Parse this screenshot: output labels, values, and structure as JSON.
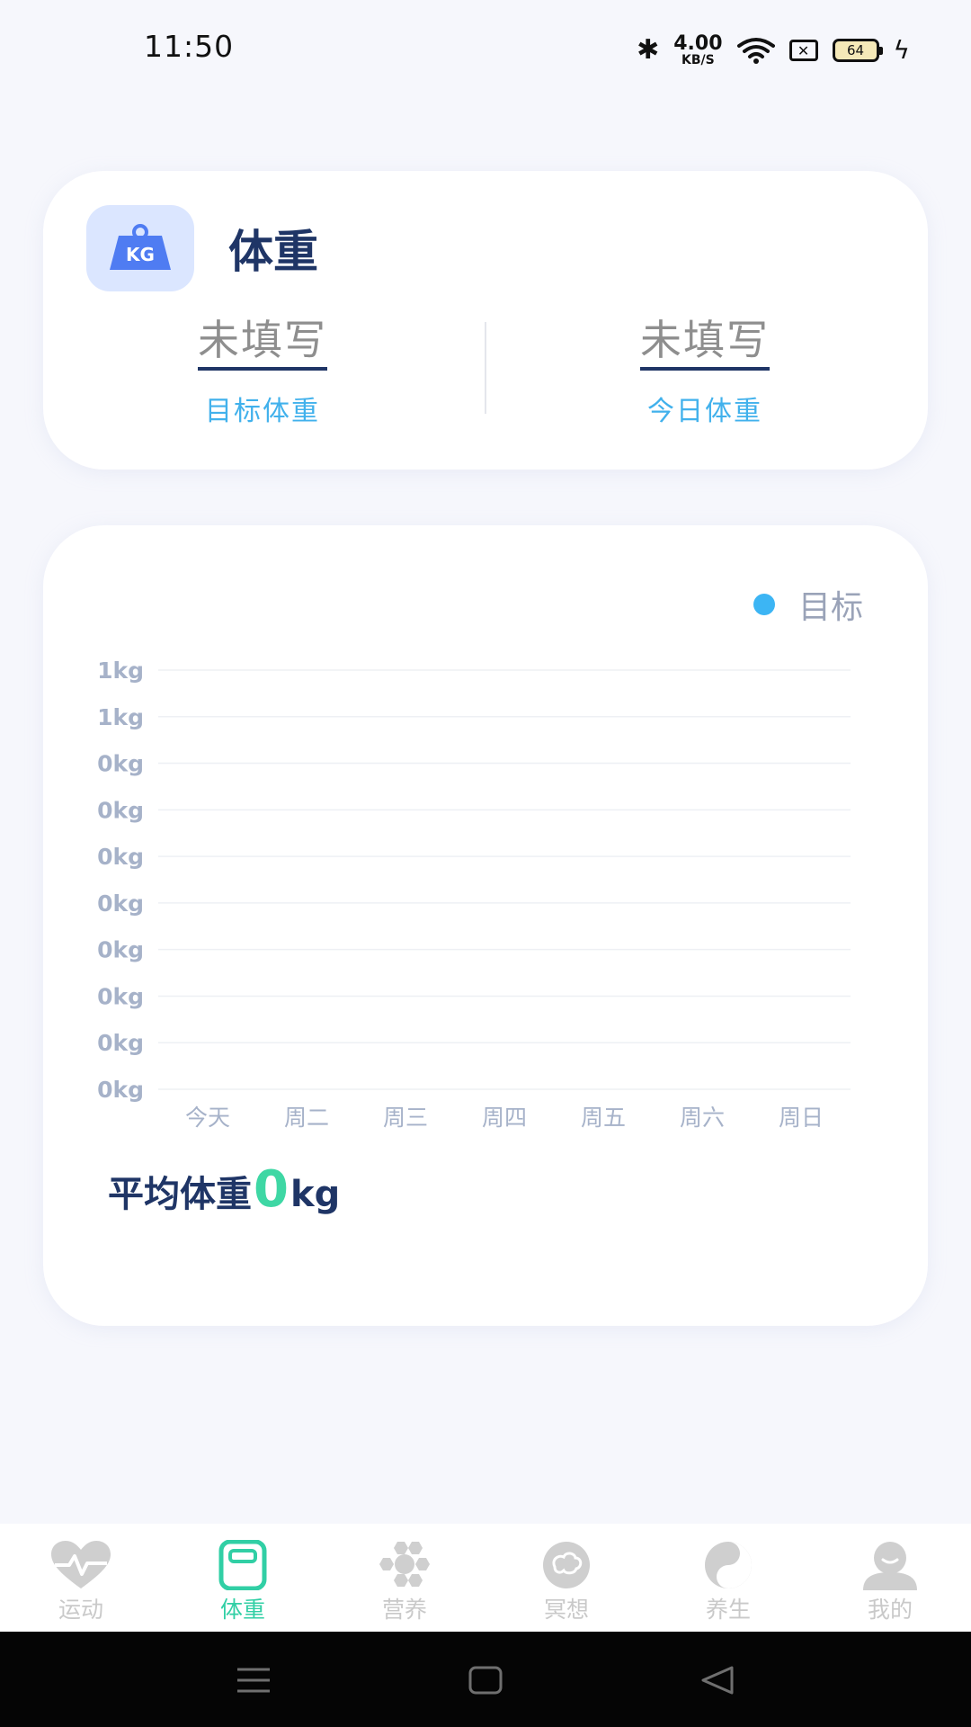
{
  "status_bar": {
    "time": "11:50",
    "net_speed_value": "4.00",
    "net_speed_unit": "KB/S",
    "battery_level": "64"
  },
  "weight_card": {
    "title": "体重",
    "icon_text": "KG",
    "target": {
      "value": "未填写",
      "label": "目标体重"
    },
    "today": {
      "value": "未填写",
      "label": "今日体重"
    }
  },
  "chart_card": {
    "legend_label": "目标",
    "average_label": "平均体重",
    "average_value": "0",
    "average_unit": "kg"
  },
  "chart_data": {
    "type": "line",
    "categories": [
      "今天",
      "周二",
      "周三",
      "周四",
      "周五",
      "周六",
      "周日"
    ],
    "y_tick_labels": [
      "1kg",
      "1kg",
      "0kg",
      "0kg",
      "0kg",
      "0kg",
      "0kg",
      "0kg",
      "0kg",
      "0kg"
    ],
    "series": [
      {
        "name": "目标",
        "values": []
      }
    ],
    "legend_position": "top-right",
    "grid": true,
    "colors": {
      "series": "#3cb5f4",
      "axis_text": "#a6b2c9",
      "grid": "#eef0f4"
    }
  },
  "tab_bar": {
    "active_index": 1,
    "tabs": [
      {
        "label": "运动",
        "icon": "heart-pulse-icon"
      },
      {
        "label": "体重",
        "icon": "scale-icon"
      },
      {
        "label": "营养",
        "icon": "honeycomb-icon"
      },
      {
        "label": "冥想",
        "icon": "brain-icon"
      },
      {
        "label": "养生",
        "icon": "yin-yang-icon"
      },
      {
        "label": "我的",
        "icon": "person-icon"
      }
    ]
  },
  "colors": {
    "accent_green": "#31cfa5",
    "accent_blue": "#41b1ec",
    "title_navy": "#1f3566"
  }
}
